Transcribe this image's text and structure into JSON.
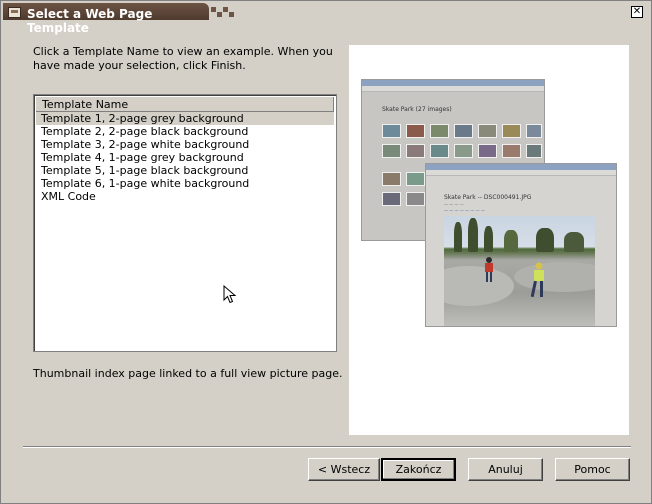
{
  "window": {
    "title": "Select a Web Page Template",
    "close_glyph": "✕"
  },
  "instructions": "Click a Template Name to view an example. When you have made your selection, click Finish.",
  "list": {
    "header": "Template Name",
    "selected_index": 0,
    "items": [
      "Template 1, 2-page grey background",
      "Template 2, 2-page black background",
      "Template 3, 2-page white background",
      "Template 4, 1-page grey background",
      "Template 5, 1-page black background",
      "Template 6, 1-page white background",
      "XML Code"
    ]
  },
  "caption": "Thumbnail index page linked to a full view picture page.",
  "preview": {
    "index_heading": "Skate Park (27 images)",
    "picture_heading": "Skate Park -- DSC000491.JPG"
  },
  "buttons": {
    "back": "< Wstecz",
    "finish": "Zakończ",
    "cancel": "Anuluj",
    "help": "Pomoc"
  },
  "colors": {
    "dialog_bg": "#d4d0c8",
    "title_tab": "#5c4536",
    "title_text": "#ffffff"
  }
}
